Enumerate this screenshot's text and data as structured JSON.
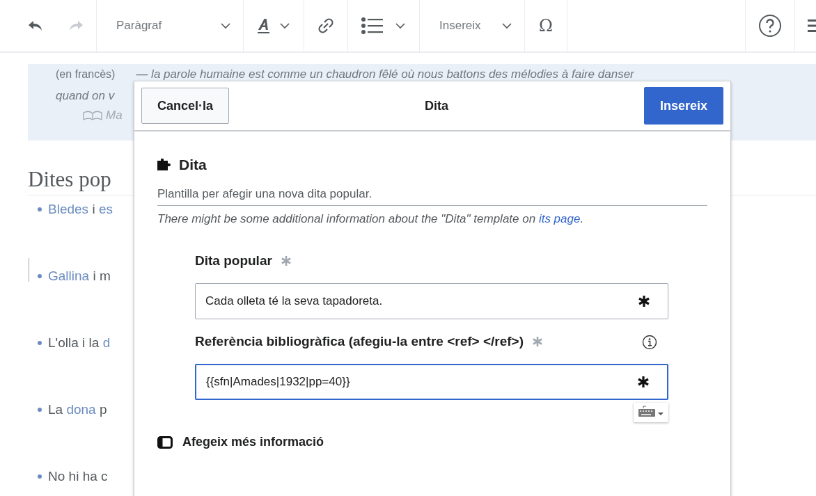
{
  "toolbar": {
    "undo": {
      "disabled": false
    },
    "redo": {
      "disabled": true
    },
    "paragraph_menu": "Paràgraf",
    "insert_menu": "Insereix",
    "special_character": "Ω"
  },
  "article": {
    "quote": {
      "language": "(en francès)",
      "text": "— la parole humaine est comme un chaudron fêlé où nous battons des mélodies à faire danser",
      "line_2": "quand on v",
      "source": "Ma"
    },
    "heading": "Dites pop",
    "items": [
      {
        "parts": [
          {
            "text": "Bledes",
            "link": true
          },
          {
            "text": " i ",
            "link": false
          },
          {
            "text": "es",
            "link": true
          }
        ]
      },
      {
        "parts": [
          {
            "text": "Gallina",
            "link": true
          },
          {
            "text": " i m",
            "link": false
          }
        ]
      },
      {
        "parts": [
          {
            "text": "L'olla i la ",
            "link": false
          },
          {
            "text": "d",
            "link": true
          }
        ]
      },
      {
        "parts": [
          {
            "text": "La ",
            "link": false
          },
          {
            "text": "dona",
            "link": true
          },
          {
            "text": " p",
            "link": false
          }
        ]
      },
      {
        "parts": [
          {
            "text": "No hi ha c",
            "link": false
          }
        ]
      }
    ]
  },
  "dialog": {
    "title": "Dita",
    "cancel": "Cancel·la",
    "confirm": "Insereix",
    "template": {
      "name": "Dita",
      "description": "Plantilla per afegir una nova dita popular.",
      "note": "There might be some additional information about the \"Dita\" template on ",
      "note_link": "its page",
      "note_end": "."
    },
    "fields": [
      {
        "label": "Dita popular",
        "value": "Cada olleta té la seva tapadoreta.",
        "required": true,
        "has_info": false,
        "focused": false
      },
      {
        "label": "Referència bibliogràfica (afegiu-la entre <ref> </ref>)",
        "value": "{{sfn|Amades|1932|pp=40}}",
        "required": true,
        "has_info": true,
        "focused": true
      }
    ],
    "more_info": "Afegeix més informació"
  }
}
